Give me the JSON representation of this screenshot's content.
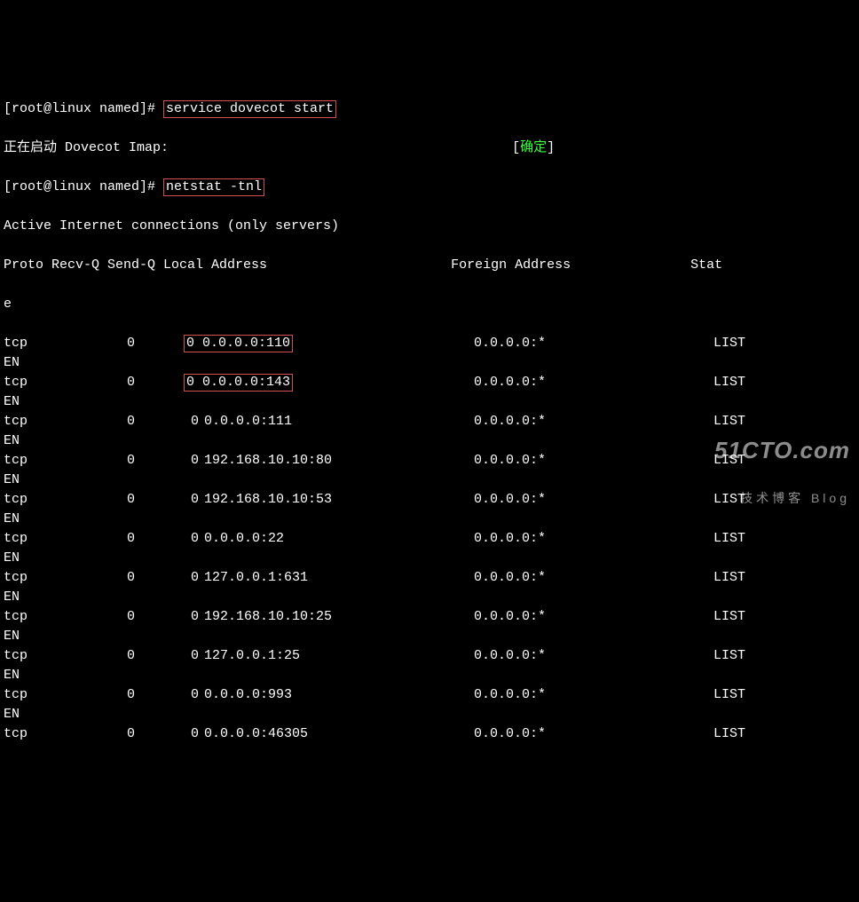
{
  "prompt": "[root@linux named]# ",
  "cmd1": "service dovecot start",
  "start_msg": "正在启动 Dovecot Imap:",
  "ok_open": "[",
  "ok_text": "确定",
  "ok_close": "]",
  "cmd2": "netstat -tnl",
  "active_line": "Active Internet connections (only servers)",
  "hdr_left": "Proto Recv-Q Send-Q Local Address",
  "hdr_foreign": "Foreign Address",
  "hdr_state": "Stat",
  "hdr_wrap": "e",
  "en": "EN",
  "rows": [
    {
      "proto": "tcp",
      "recvq": "0",
      "sendq": "0",
      "local": "0.0.0.0:110",
      "foreign": "0.0.0.0:*",
      "state": "LIST",
      "hl": true
    },
    {
      "proto": "tcp",
      "recvq": "0",
      "sendq": "0",
      "local": "0.0.0.0:143",
      "foreign": "0.0.0.0:*",
      "state": "LIST",
      "hl": true
    },
    {
      "proto": "tcp",
      "recvq": "0",
      "sendq": "0",
      "local": "0.0.0.0:111",
      "foreign": "0.0.0.0:*",
      "state": "LIST",
      "hl": false
    },
    {
      "proto": "tcp",
      "recvq": "0",
      "sendq": "0",
      "local": "192.168.10.10:80",
      "foreign": "0.0.0.0:*",
      "state": "LIST",
      "hl": false
    },
    {
      "proto": "tcp",
      "recvq": "0",
      "sendq": "0",
      "local": "192.168.10.10:53",
      "foreign": "0.0.0.0:*",
      "state": "LIST",
      "hl": false
    },
    {
      "proto": "tcp",
      "recvq": "0",
      "sendq": "0",
      "local": "0.0.0.0:22",
      "foreign": "0.0.0.0:*",
      "state": "LIST",
      "hl": false
    },
    {
      "proto": "tcp",
      "recvq": "0",
      "sendq": "0",
      "local": "127.0.0.1:631",
      "foreign": "0.0.0.0:*",
      "state": "LIST",
      "hl": false
    },
    {
      "proto": "tcp",
      "recvq": "0",
      "sendq": "0",
      "local": "192.168.10.10:25",
      "foreign": "0.0.0.0:*",
      "state": "LIST",
      "hl": false
    },
    {
      "proto": "tcp",
      "recvq": "0",
      "sendq": "0",
      "local": "127.0.0.1:25",
      "foreign": "0.0.0.0:*",
      "state": "LIST",
      "hl": false
    },
    {
      "proto": "tcp",
      "recvq": "0",
      "sendq": "0",
      "local": "0.0.0.0:993",
      "foreign": "0.0.0.0:*",
      "state": "LIST",
      "hl": false
    },
    {
      "proto": "tcp",
      "recvq": "0",
      "sendq": "0",
      "local": "0.0.0.0:46305",
      "foreign": "0.0.0.0:*",
      "state": "LIST",
      "hl": false
    }
  ],
  "watermark": {
    "big": "51CTO.com",
    "small": "技术博客 Blog"
  }
}
